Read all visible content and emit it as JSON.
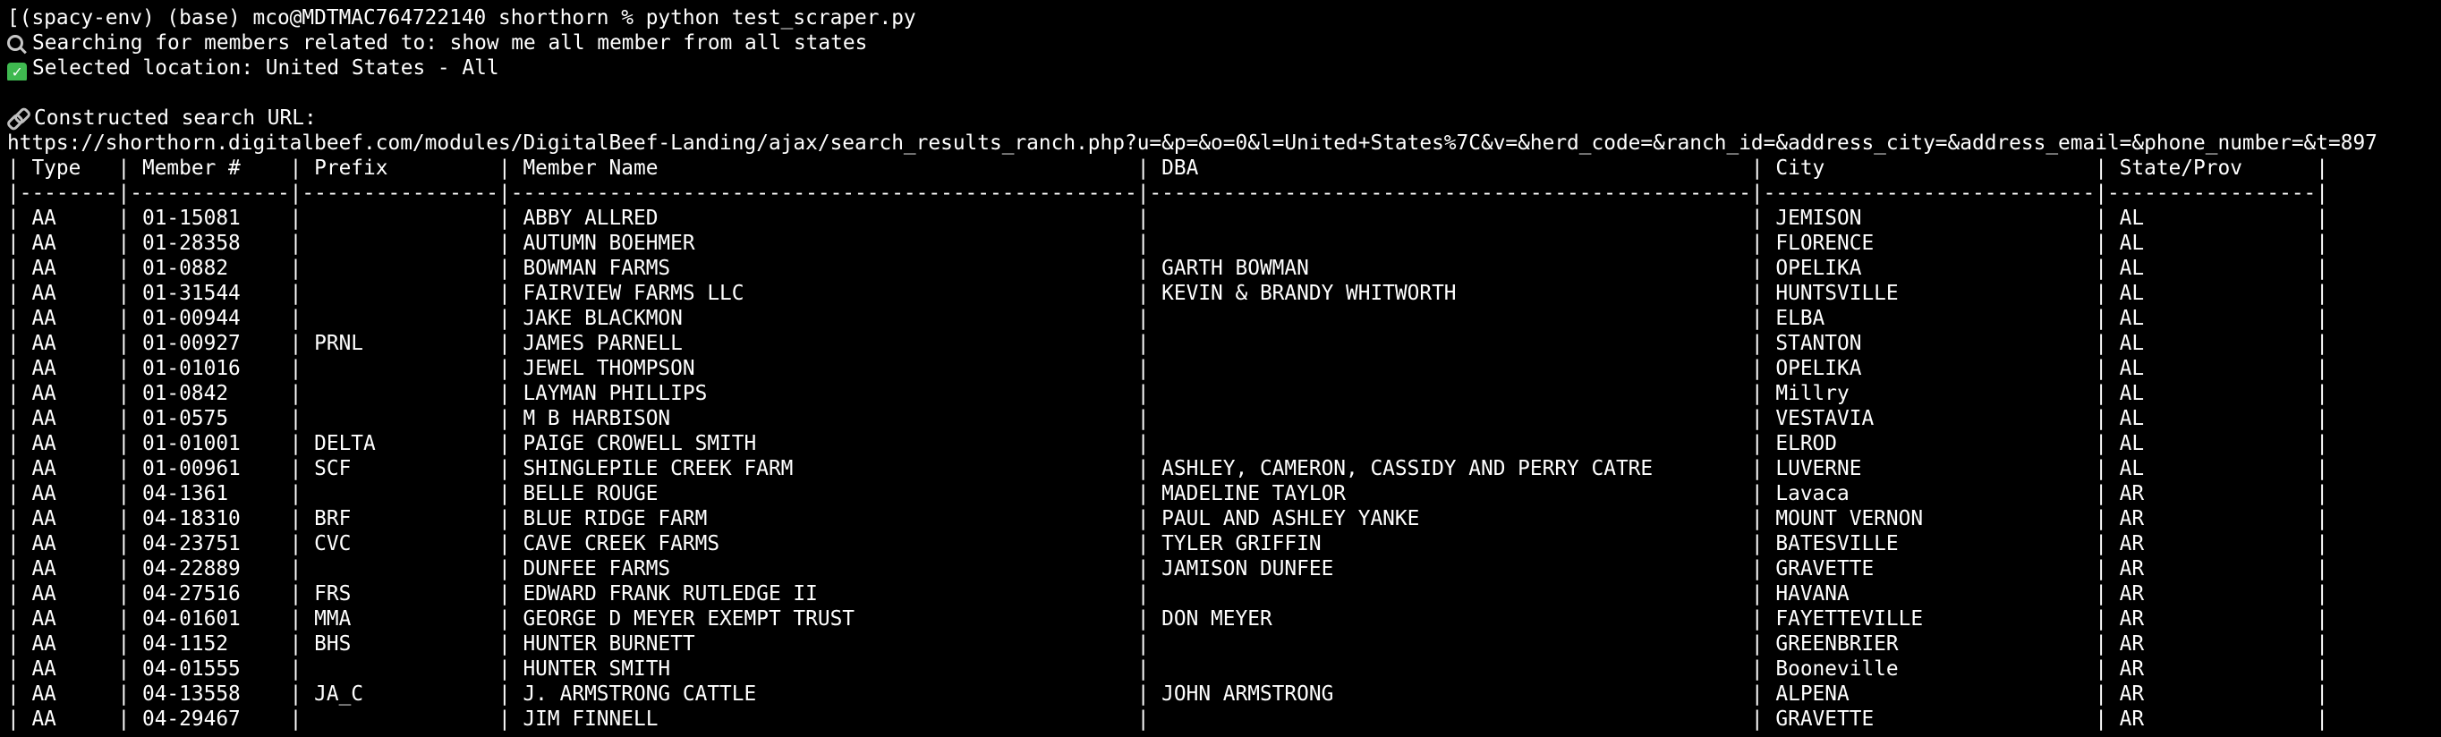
{
  "terminal": {
    "prompt_line": "(spacy-env) (base) mco@MDTMAC764722140 shorthorn % python test_scraper.py",
    "prompt_prefix": "[",
    "searching_text": "Searching for members related to: show me all member from all states",
    "searching_icon": "search-icon",
    "selected_text": "Selected location: United States - All",
    "selected_icon": "check-icon",
    "url_label": "Constructed search URL:",
    "url_icon": "link-icon",
    "url": "https://shorthorn.digitalbeef.com/modules/DigitalBeef-Landing/ajax/search_results_ranch.php?u=&p=&o=0&l=United+States%7C&v=&herd_code=&ranch_id=&address_city=&address_email=&phone_number=&t=897"
  },
  "table": {
    "headers": [
      "Type",
      "Member #",
      "Prefix",
      "Member Name",
      "DBA",
      "City",
      "State/Prov"
    ],
    "widths": [
      8,
      13,
      16,
      51,
      49,
      27,
      17
    ],
    "rows": [
      [
        "AA",
        "01-15081",
        "",
        "ABBY ALLRED",
        "",
        "JEMISON",
        "AL"
      ],
      [
        "AA",
        "01-28358",
        "",
        "AUTUMN BOEHMER",
        "",
        "FLORENCE",
        "AL"
      ],
      [
        "AA",
        "01-0882",
        "",
        "BOWMAN FARMS",
        "GARTH BOWMAN",
        "OPELIKA",
        "AL"
      ],
      [
        "AA",
        "01-31544",
        "",
        "FAIRVIEW FARMS LLC",
        "KEVIN & BRANDY WHITWORTH",
        "HUNTSVILLE",
        "AL"
      ],
      [
        "AA",
        "01-00944",
        "",
        "JAKE BLACKMON",
        "",
        "ELBA",
        "AL"
      ],
      [
        "AA",
        "01-00927",
        "PRNL",
        "JAMES PARNELL",
        "",
        "STANTON",
        "AL"
      ],
      [
        "AA",
        "01-01016",
        "",
        "JEWEL THOMPSON",
        "",
        "OPELIKA",
        "AL"
      ],
      [
        "AA",
        "01-0842",
        "",
        "LAYMAN PHILLIPS",
        "",
        "Millry",
        "AL"
      ],
      [
        "AA",
        "01-0575",
        "",
        "M B HARBISON",
        "",
        "VESTAVIA",
        "AL"
      ],
      [
        "AA",
        "01-01001",
        "DELTA",
        "PAIGE CROWELL SMITH",
        "",
        "ELROD",
        "AL"
      ],
      [
        "AA",
        "01-00961",
        "SCF",
        "SHINGLEPILE CREEK FARM",
        "ASHLEY, CAMERON, CASSIDY AND PERRY CATRE",
        "LUVERNE",
        "AL"
      ],
      [
        "AA",
        "04-1361",
        "",
        "BELLE ROUGE",
        "MADELINE TAYLOR",
        "Lavaca",
        "AR"
      ],
      [
        "AA",
        "04-18310",
        "BRF",
        "BLUE RIDGE FARM",
        "PAUL AND ASHLEY YANKE",
        "MOUNT VERNON",
        "AR"
      ],
      [
        "AA",
        "04-23751",
        "CVC",
        "CAVE CREEK FARMS",
        "TYLER GRIFFIN",
        "BATESVILLE",
        "AR"
      ],
      [
        "AA",
        "04-22889",
        "",
        "DUNFEE FARMS",
        "JAMISON DUNFEE",
        "GRAVETTE",
        "AR"
      ],
      [
        "AA",
        "04-27516",
        "FRS",
        "EDWARD FRANK RUTLEDGE II",
        "",
        "HAVANA",
        "AR"
      ],
      [
        "AA",
        "04-01601",
        "MMA",
        "GEORGE D MEYER EXEMPT TRUST",
        "DON MEYER",
        "FAYETTEVILLE",
        "AR"
      ],
      [
        "AA",
        "04-1152",
        "BHS",
        "HUNTER BURNETT",
        "",
        "GREENBRIER",
        "AR"
      ],
      [
        "AA",
        "04-01555",
        "",
        "HUNTER SMITH",
        "",
        "Booneville",
        "AR"
      ],
      [
        "AA",
        "04-13558",
        "JA_C",
        "J. ARMSTRONG CATTLE",
        "JOHN ARMSTRONG",
        "ALPENA",
        "AR"
      ],
      [
        "AA",
        "04-29467",
        "",
        "JIM FINNELL",
        "",
        "GRAVETTE",
        "AR"
      ]
    ]
  },
  "colors": {
    "background": "#000000",
    "text": "#ffffff",
    "check_green": "#3fb950"
  }
}
